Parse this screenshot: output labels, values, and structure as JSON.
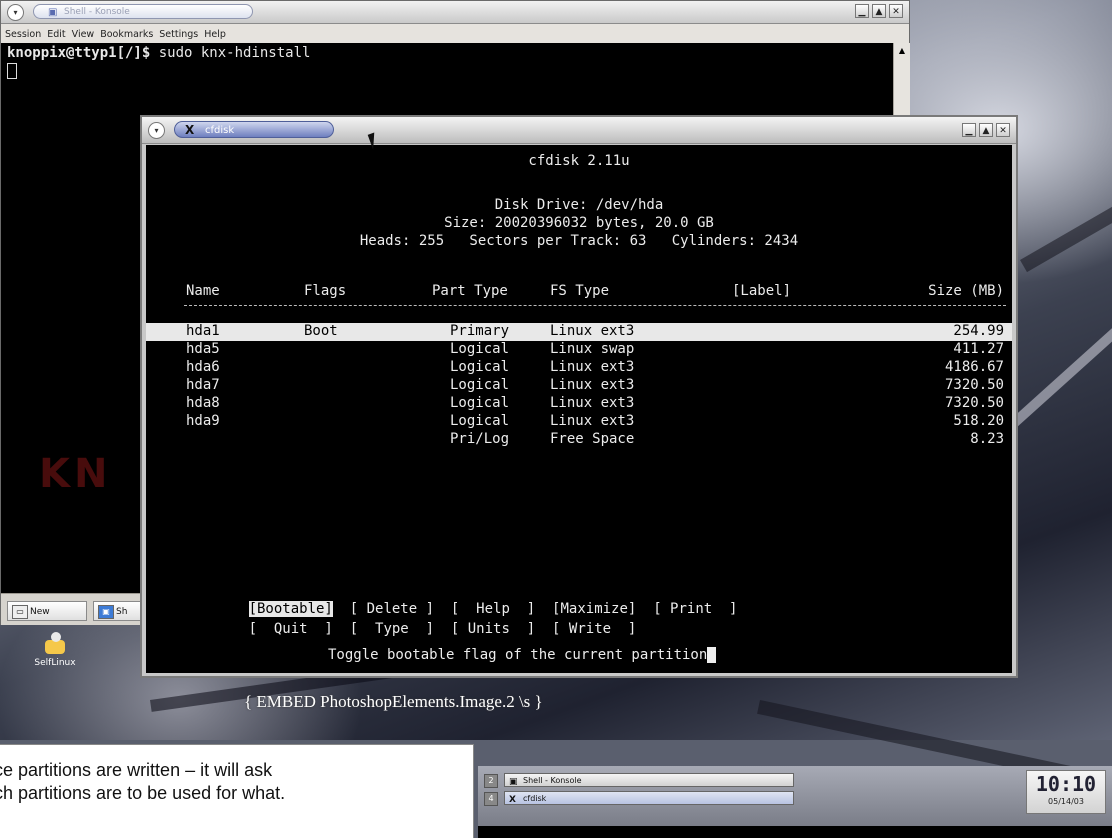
{
  "konsole": {
    "title": "Shell - Konsole",
    "menu": [
      "Session",
      "Edit",
      "View",
      "Bookmarks",
      "Settings",
      "Help"
    ],
    "prompt": "knoppix@ttyp1[/]$",
    "command": " sudo knx-hdinstall",
    "tabs": [
      {
        "label": "New",
        "icon": "new-session-icon"
      },
      {
        "label": "Sh",
        "icon": "shell-icon"
      }
    ],
    "background_logo": "KN"
  },
  "desktop_icon": {
    "label": "SelfLinux",
    "icon": "selflinux-icon"
  },
  "cfdisk": {
    "window_title": "cfdisk",
    "program": "cfdisk 2.11u",
    "disk_drive": "Disk Drive: /dev/hda",
    "size": "Size: 20020396032 bytes, 20.0 GB",
    "geometry": "Heads: 255   Sectors per Track: 63   Cylinders: 2434",
    "columns": [
      "Name",
      "Flags",
      "Part Type",
      "FS Type",
      "[Label]",
      "Size (MB)"
    ],
    "partitions": [
      {
        "name": "hda1",
        "flags": "Boot",
        "part_type": "Primary",
        "fs_type": "Linux ext3",
        "label": "",
        "size": "254.99"
      },
      {
        "name": "hda5",
        "flags": "",
        "part_type": "Logical",
        "fs_type": "Linux swap",
        "label": "",
        "size": "411.27"
      },
      {
        "name": "hda6",
        "flags": "",
        "part_type": "Logical",
        "fs_type": "Linux ext3",
        "label": "",
        "size": "4186.67"
      },
      {
        "name": "hda7",
        "flags": "",
        "part_type": "Logical",
        "fs_type": "Linux ext3",
        "label": "",
        "size": "7320.50"
      },
      {
        "name": "hda8",
        "flags": "",
        "part_type": "Logical",
        "fs_type": "Linux ext3",
        "label": "",
        "size": "7320.50"
      },
      {
        "name": "hda9",
        "flags": "",
        "part_type": "Logical",
        "fs_type": "Linux ext3",
        "label": "",
        "size": "518.20"
      },
      {
        "name": "",
        "flags": "",
        "part_type": "Pri/Log",
        "fs_type": "Free Space",
        "label": "",
        "size": "8.23"
      }
    ],
    "menu_row1": [
      "[Bootable]",
      "[ Delete ]",
      "[  Help  ]",
      "[Maximize]",
      "[ Print  ]"
    ],
    "menu_row2": [
      "[  Quit  ]",
      "[  Type  ]",
      "[ Units  ]",
      "[ Write  ]"
    ],
    "status": "Toggle bootable flag of the current partition"
  },
  "embed_caption": "{ EMBED PhotoshopElements.Image.2 \\s }",
  "taskbar": {
    "tasks": [
      {
        "desk": "2",
        "label": "Shell - Konsole"
      },
      {
        "desk": "4",
        "label": "cfdisk"
      }
    ],
    "clock": "10:10",
    "date": "05/14/03"
  },
  "document_text": {
    "line1": "ce partitions are written – it will ask",
    "line2": "ch partitions are to be used for what."
  }
}
